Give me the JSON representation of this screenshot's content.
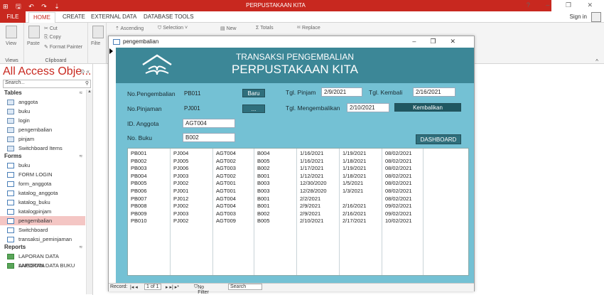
{
  "app": {
    "title": "PERPUSTAKAAN KITA",
    "window_controls": "? – ❐ ✕",
    "qat": "⊞ 🖫 ↶ ↷ ⇣"
  },
  "tabs": {
    "file": "FILE",
    "home": "HOME",
    "create": "CREATE",
    "external": "EXTERNAL DATA",
    "dbtools": "DATABASE TOOLS",
    "signin": "Sign in"
  },
  "ribbon": {
    "view": "View",
    "paste": "Paste",
    "cut": "Cut",
    "copy": "Copy",
    "format_painter": "Format Painter",
    "filter": "Filte",
    "ascending": "Ascending",
    "selection": "Selection ˅",
    "new": "New",
    "totals": "Totals",
    "replace": "Replace",
    "views_label": "Views",
    "clipboard_label": "Clipboard"
  },
  "nav": {
    "header": "All Access Obje...",
    "search_placeholder": "Search...",
    "sections": [
      {
        "label": "Tables",
        "items": [
          {
            "label": "anggota",
            "kind": "table"
          },
          {
            "label": "buku",
            "kind": "table"
          },
          {
            "label": "login",
            "kind": "table"
          },
          {
            "label": "pengembalian",
            "kind": "table"
          },
          {
            "label": "pinjam",
            "kind": "table"
          },
          {
            "label": "Switchboard Items",
            "kind": "table"
          }
        ]
      },
      {
        "label": "Forms",
        "items": [
          {
            "label": "buku",
            "kind": "form"
          },
          {
            "label": "FORM LOGIN",
            "kind": "form"
          },
          {
            "label": "form_anggota",
            "kind": "form"
          },
          {
            "label": "katalog_anggota",
            "kind": "form"
          },
          {
            "label": "katalog_buku",
            "kind": "form"
          },
          {
            "label": "katalogpinjam",
            "kind": "form"
          },
          {
            "label": "pengembalian",
            "kind": "form",
            "selected": true
          },
          {
            "label": "Switchboard",
            "kind": "form"
          },
          {
            "label": "transaksi_peminjaman",
            "kind": "form"
          }
        ]
      },
      {
        "label": "Reports",
        "items": [
          {
            "label": "LAPORAN DATA ANGGOTA",
            "kind": "report"
          },
          {
            "label": "LAPORAN DATA BUKU",
            "kind": "report"
          }
        ]
      }
    ]
  },
  "window": {
    "title": "pengembalian"
  },
  "form": {
    "header_line1": "TRANSAKSI PENGEMBALIAN",
    "header_line2": "PERPUSTAKAAN KITA",
    "no_pengembalian_label": "No.Pengembalian",
    "no_pengembalian_value": "PB011",
    "baru_button": "Baru",
    "tgl_pinjam_label": "Tgl. Pinjam",
    "tgl_pinjam_value": "2/9/2021",
    "tgl_kembali_label": "Tgl. Kembali",
    "tgl_kembali_value": "2/16/2021",
    "no_pinjaman_label": "No.Pinjaman",
    "no_pinjaman_value": "PJ001",
    "lookup_button": "...",
    "tgl_mengembalikan_label": "Tgl. Mengembalikan",
    "tgl_mengembalikan_value": "2/10/2021",
    "kembalikan_button": "Kembalikan",
    "id_anggota_label": "ID. Anggota",
    "id_anggota_value": "AGT004",
    "no_buku_label": "No. Buku",
    "no_buku_value": "B002",
    "dashboard_button": "DASHBOARD"
  },
  "grid_rows": [
    [
      "PB001",
      "PJ004",
      "AGT004",
      "B004",
      "1/16/2021",
      "1/19/2021",
      "08/02/2021"
    ],
    [
      "PB002",
      "PJ005",
      "AGT002",
      "B005",
      "1/16/2021",
      "1/18/2021",
      "08/02/2021"
    ],
    [
      "PB003",
      "PJ006",
      "AGT003",
      "B002",
      "1/17/2021",
      "1/19/2021",
      "08/02/2021"
    ],
    [
      "PB004",
      "PJ003",
      "AGT002",
      "B001",
      "1/12/2021",
      "1/18/2021",
      "08/02/2021"
    ],
    [
      "PB005",
      "PJ002",
      "AGT001",
      "B003",
      "12/30/2020",
      "1/5/2021",
      "08/02/2021"
    ],
    [
      "PB006",
      "PJ001",
      "AGT001",
      "B003",
      "12/28/2020",
      "1/3/2021",
      "08/02/2021"
    ],
    [
      "PB007",
      "PJ012",
      "AGT004",
      "B001",
      "2/2/2021",
      "",
      "08/02/2021"
    ],
    [
      "PB008",
      "PJ002",
      "AGT004",
      "B001",
      "2/9/2021",
      "2/16/2021",
      "09/02/2021"
    ],
    [
      "PB009",
      "PJ003",
      "AGT003",
      "B002",
      "2/9/2021",
      "2/16/2021",
      "09/02/2021"
    ],
    [
      "PB010",
      "PJ002",
      "AGT009",
      "B005",
      "2/10/2021",
      "2/17/2021",
      "10/02/2021"
    ]
  ],
  "record_bar": {
    "label": "Record:",
    "position": "1 of 1",
    "filter": "No Filter",
    "search": "Search"
  },
  "colors": {
    "accent": "#c8281f",
    "form_bg": "#74c1d4",
    "form_header": "#3c8797",
    "button": "#2f6f7c"
  }
}
